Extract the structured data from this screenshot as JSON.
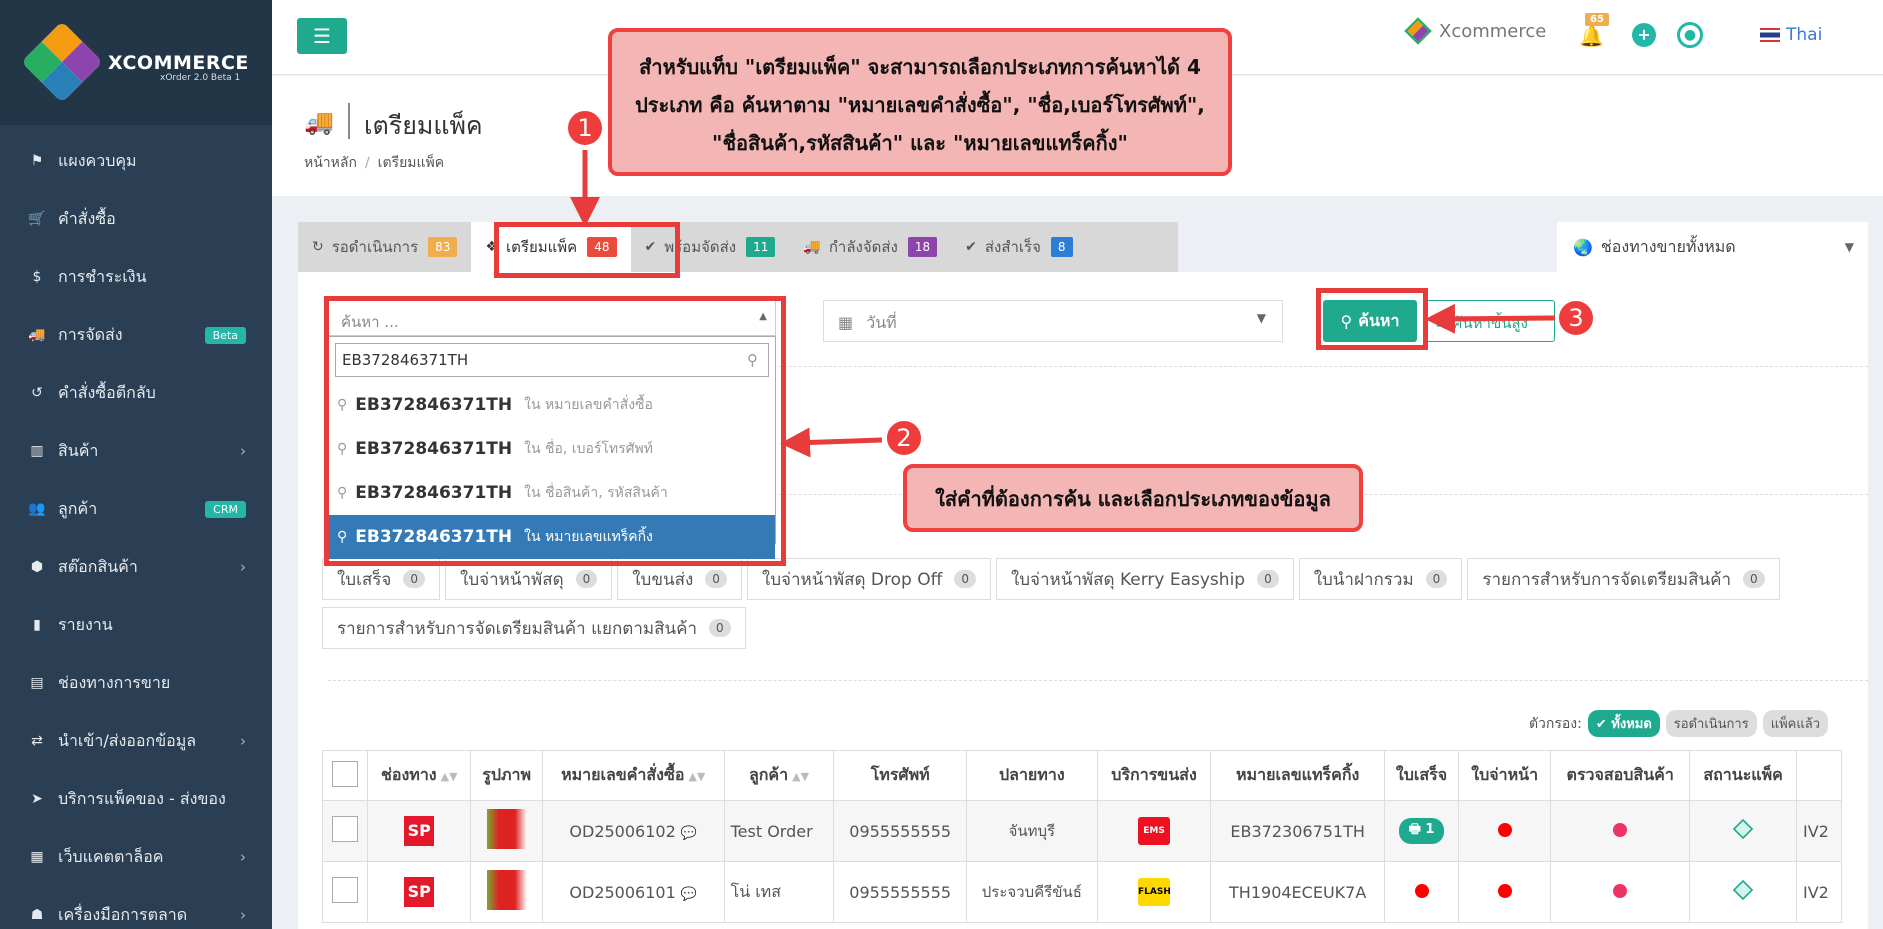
{
  "brand": {
    "name": "XCOMMERCE",
    "sub": "xOrder 2.0 Beta 1"
  },
  "sidebar": {
    "items": [
      {
        "label": "แผงควบคุม",
        "icon": "flag-icon",
        "glyph": "⚑"
      },
      {
        "label": "คำสั่งซื้อ",
        "icon": "cart-icon",
        "glyph": "🛒"
      },
      {
        "label": "การชำระเงิน",
        "icon": "dollar-icon",
        "glyph": "$"
      },
      {
        "label": "การจัดส่ง",
        "icon": "truck-icon",
        "glyph": "🚚",
        "badge": "Beta"
      },
      {
        "label": "คำสั่งซื้อตีกลับ",
        "icon": "undo-icon",
        "glyph": "↺"
      },
      {
        "label": "สินค้า",
        "icon": "barcode-icon",
        "glyph": "▥",
        "arrow": "›"
      },
      {
        "label": "ลูกค้า",
        "icon": "users-icon",
        "glyph": "👥",
        "badge": "CRM"
      },
      {
        "label": "สต๊อกสินค้า",
        "icon": "cubes-icon",
        "glyph": "⬢",
        "arrow": "›"
      },
      {
        "label": "รายงาน",
        "icon": "chart-icon",
        "glyph": "▮"
      },
      {
        "label": "ช่องทางการขาย",
        "icon": "store-icon",
        "glyph": "▤"
      },
      {
        "label": "นำเข้า/ส่งออกข้อมูล",
        "icon": "exchange-icon",
        "glyph": "⇄",
        "arrow": "›"
      },
      {
        "label": "บริการแพ็คของ - ส่งของ",
        "icon": "send-icon",
        "glyph": "➤"
      },
      {
        "label": "เว็บแคตตาล็อค",
        "icon": "basket-icon",
        "glyph": "▦",
        "arrow": "›"
      },
      {
        "label": "เครื่องมือการตลาด",
        "icon": "tools-icon",
        "glyph": "☗",
        "arrow": "›"
      }
    ]
  },
  "topbar": {
    "company": "Xcommerce",
    "notif_count": "65",
    "lang": "Thai"
  },
  "page": {
    "title": "เตรียมแพ็ค",
    "crumb_home": "หน้าหลัก",
    "crumb_current": "เตรียมแพ็ค"
  },
  "tabs": [
    {
      "label": "รอดำเนินการ",
      "count": "83",
      "color": "#f0ad4e",
      "glyph": "↻"
    },
    {
      "label": "เตรียมแพ็ค",
      "count": "48",
      "color": "#e74c3c",
      "glyph": "❖"
    },
    {
      "label": "พร้อมจัดส่ง",
      "count": "11",
      "color": "#1fa98e",
      "glyph": "✔"
    },
    {
      "label": "กำลังจัดส่ง",
      "count": "18",
      "color": "#8e44ad",
      "glyph": "🚚"
    },
    {
      "label": "ส่งสำเร็จ",
      "count": "8",
      "color": "#2a7fd4",
      "glyph": "✔"
    }
  ],
  "channel_filter": "ช่องทางขายทั้งหมด",
  "search": {
    "placeholder": "ค้นหา ...",
    "query": "EB372846371TH",
    "options": [
      {
        "term": "EB372846371TH",
        "scope": "ใน หมายเลขคำสั่งซื้อ"
      },
      {
        "term": "EB372846371TH",
        "scope": "ใน ชื่อ, เบอร์โทรศัพท์"
      },
      {
        "term": "EB372846371TH",
        "scope": "ใน ชื่อสินค้า, รหัสสินค้า"
      },
      {
        "term": "EB372846371TH",
        "scope": "ใน หมายเลขแทร็คกิ้ง"
      }
    ],
    "date_placeholder": "วันที่",
    "search_button": "ค้นหา",
    "advanced_button": "ค้นหาขั้นสูง"
  },
  "doc_buttons": [
    {
      "label": "ใบเสร็จ",
      "count": "0"
    },
    {
      "label": "ใบจ่าหน้าพัสดุ",
      "count": "0"
    },
    {
      "label": "ใบขนส่ง",
      "count": "0"
    },
    {
      "label": "ใบจ่าหน้าพัสดุ Drop Off",
      "count": "0"
    },
    {
      "label": "ใบจ่าหน้าพัสดุ Kerry Easyship",
      "count": "0"
    },
    {
      "label": "ใบนำฝากรวม",
      "count": "0"
    },
    {
      "label": "รายการสำหรับการจัดเตรียมสินค้า",
      "count": "0"
    },
    {
      "label": "รายการสำหรับการจัดเตรียมสินค้า แยกตามสินค้า",
      "count": "0"
    }
  ],
  "filters": {
    "label": "ตัวกรอง:",
    "all": "ทั้งหมด",
    "pending": "รอดำเนินการ",
    "packed": "แพ็คแล้ว"
  },
  "table": {
    "headers": [
      "ช่องทาง",
      "รูปภาพ",
      "หมายเลขคำสั่งซื้อ",
      "ลูกค้า",
      "โทรศัพท์",
      "ปลายทาง",
      "บริการขนส่ง",
      "หมายเลขแทร็คกิ้ง",
      "ใบเสร็จ",
      "ใบจ่าหน้า",
      "ตรวจสอบสินค้า",
      "สถานะแพ็ค"
    ],
    "rows": [
      {
        "channel": "SP",
        "order": "OD25006102",
        "customer": "Test Order",
        "phone": "0955555555",
        "dest": "จันทบุรี",
        "carrier": "EMS",
        "tracking": "EB372306751TH",
        "receipt": "1",
        "extra": "IV2"
      },
      {
        "channel": "SP",
        "order": "OD25006101",
        "customer": "โน่ เทส",
        "phone": "0955555555",
        "dest": "ประจวบคีรีขันธ์",
        "carrier": "FLASH",
        "tracking": "TH1904ECEUK7A",
        "receipt": "",
        "extra": "IV2"
      }
    ]
  },
  "callouts": {
    "c1": "สำหรับแท็บ \"เตรียมแพ็ค\" จะสามารถเลือกประเภทการค้นหาได้ 4 ประเภท คือ ค้นหาตาม \"หมายเลขคำสั่งซื้อ\", \"ชื่อ,เบอร์โทรศัพท์\", \"ชื่อสินค้า,รหัสสินค้า\" และ \"หมายเลขแทร็คกิ้ง\"",
    "c2": "ใส่คำที่ต้องการค้น และเลือกประเภทของข้อมูล",
    "n1": "1",
    "n2": "2",
    "n3": "3"
  },
  "colors": {
    "accent": "#1fa98e",
    "sidebar": "#2a3f54",
    "callout_border": "#f0403f",
    "callout_fill": "#f4b5b5"
  }
}
